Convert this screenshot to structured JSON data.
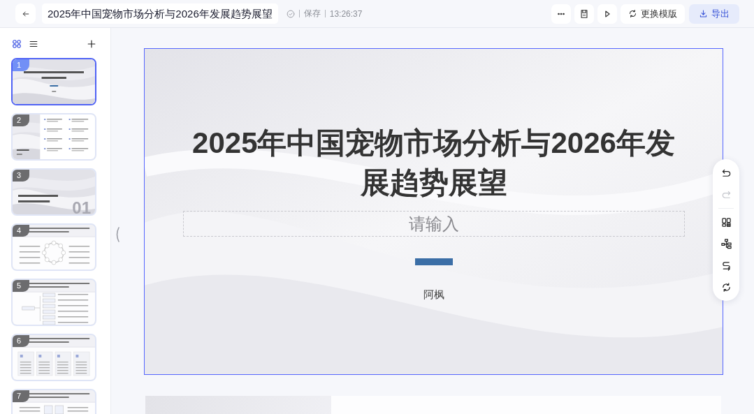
{
  "header": {
    "title": "2025年中国宠物市场分析与2026年发展趋势展望",
    "save_status": "保存",
    "saved_time": "13:26:37",
    "buttons": [
      {
        "kind": "more"
      },
      {
        "kind": "save"
      },
      {
        "kind": "play"
      },
      {
        "kind": "template",
        "label": "更换模版"
      },
      {
        "kind": "export",
        "label": "导出"
      }
    ]
  },
  "sidebar": {
    "view_tabs": [
      {
        "kind": "grid",
        "selected": true
      },
      {
        "kind": "list",
        "selected": false
      }
    ],
    "slides": [
      {
        "number": "1",
        "kind": "title",
        "selected": true
      },
      {
        "number": "2",
        "kind": "contents",
        "selected": false
      },
      {
        "number": "3",
        "kind": "section",
        "selected": false,
        "big_text": "01"
      },
      {
        "number": "4",
        "kind": "cycle",
        "selected": false
      },
      {
        "number": "5",
        "kind": "tree",
        "selected": false
      },
      {
        "number": "6",
        "kind": "cards",
        "selected": false
      },
      {
        "number": "7",
        "kind": "diagram",
        "selected": false
      }
    ]
  },
  "slide": {
    "selected": true,
    "title": "2025年中国宠物市场分析与2026年发展趋势展望",
    "subtitle_placeholder": "请输入",
    "author": "阿枫"
  },
  "toolbar": {
    "groups": [
      [
        {
          "kind": "undo",
          "disabled": false
        },
        {
          "kind": "redo",
          "disabled": true
        }
      ],
      [
        {
          "kind": "layout",
          "disabled": false
        },
        {
          "kind": "hierarchy",
          "disabled": false
        },
        {
          "kind": "convert",
          "disabled": false
        },
        {
          "kind": "refresh",
          "disabled": false
        }
      ]
    ]
  }
}
